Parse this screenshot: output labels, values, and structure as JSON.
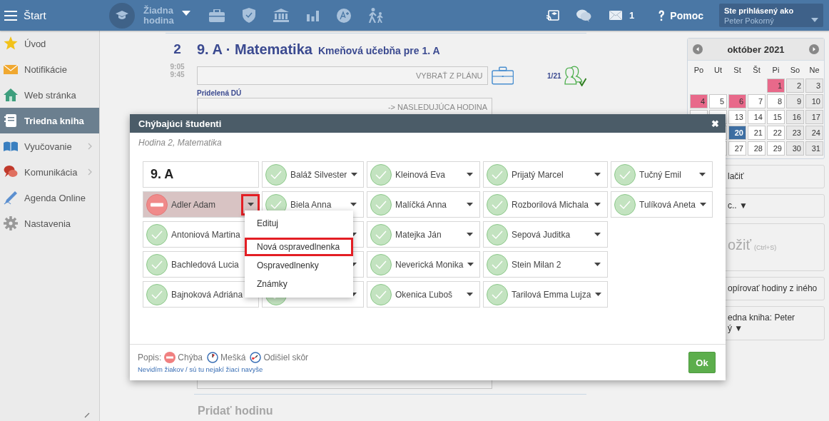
{
  "topbar": {
    "brand": "Štart",
    "lesson_selector": "Žiadna hodina",
    "mail_count": "1",
    "help": "Pomoc",
    "user_caption": "Ste prihlásený ako",
    "user_name": "Peter Pokorný"
  },
  "sidebar": {
    "items": [
      {
        "label": "Úvod",
        "selected": false,
        "has_submenu": false
      },
      {
        "label": "Notifikácie",
        "selected": false,
        "has_submenu": false
      },
      {
        "label": "Web stránka",
        "selected": false,
        "has_submenu": false
      },
      {
        "label": "Triedna kniha",
        "selected": true,
        "has_submenu": false
      },
      {
        "label": "Vyučovanie",
        "selected": false,
        "has_submenu": true
      },
      {
        "label": "Komunikácia",
        "selected": false,
        "has_submenu": true
      },
      {
        "label": "Agenda Online",
        "selected": false,
        "has_submenu": false
      },
      {
        "label": "Nastavenia",
        "selected": false,
        "has_submenu": false
      }
    ]
  },
  "lesson": {
    "number": "2",
    "start": "9:05",
    "end": "9:45",
    "title": "9. A · Matematika",
    "room": "Kmeňová učebňa pre 1. A",
    "plan_button": "VYBRAŤ Z PLÁNU",
    "attendance": "1/21",
    "homework_label": "Pridelená DÚ",
    "homework_button": "-> NASLEDUJÚCA HODINA",
    "add_lesson": "Pridať hodinu"
  },
  "calendar": {
    "title": "október 2021",
    "weekdays": [
      "Po",
      "Ut",
      "St",
      "Št",
      "Pi",
      "So",
      "Ne"
    ],
    "weeks": [
      [
        {
          "kind": "empty"
        },
        {
          "kind": "empty"
        },
        {
          "kind": "empty"
        },
        {
          "kind": "empty"
        },
        {
          "kind": "day",
          "day": "1",
          "weekend": false,
          "marked": true,
          "selected": false
        },
        {
          "kind": "day",
          "day": "2",
          "weekend": true,
          "marked": false,
          "selected": false
        },
        {
          "kind": "day",
          "day": "3",
          "weekend": true,
          "marked": false,
          "selected": false
        }
      ],
      [
        {
          "kind": "day",
          "day": "4",
          "weekend": false,
          "marked": true,
          "selected": false
        },
        {
          "kind": "day",
          "day": "5",
          "weekend": false,
          "marked": false,
          "selected": false
        },
        {
          "kind": "day",
          "day": "6",
          "weekend": false,
          "marked": true,
          "selected": false
        },
        {
          "kind": "day",
          "day": "7",
          "weekend": false,
          "marked": false,
          "selected": false
        },
        {
          "kind": "day",
          "day": "8",
          "weekend": false,
          "marked": false,
          "selected": false
        },
        {
          "kind": "day",
          "day": "9",
          "weekend": true,
          "marked": false,
          "selected": false
        },
        {
          "kind": "day",
          "day": "10",
          "weekend": true,
          "marked": false,
          "selected": false
        }
      ],
      [
        {
          "kind": "covered"
        },
        {
          "kind": "covered"
        },
        {
          "kind": "day",
          "day": "13",
          "weekend": false,
          "marked": false,
          "selected": false
        },
        {
          "kind": "day",
          "day": "14",
          "weekend": false,
          "marked": false,
          "selected": false
        },
        {
          "kind": "day",
          "day": "15",
          "weekend": false,
          "marked": false,
          "selected": false
        },
        {
          "kind": "day",
          "day": "16",
          "weekend": true,
          "marked": false,
          "selected": false
        },
        {
          "kind": "day",
          "day": "17",
          "weekend": true,
          "marked": false,
          "selected": false
        }
      ],
      [
        {
          "kind": "empty"
        },
        {
          "kind": "covered"
        },
        {
          "kind": "day",
          "day": "20",
          "weekend": false,
          "marked": false,
          "selected": true
        },
        {
          "kind": "day",
          "day": "21",
          "weekend": false,
          "marked": false,
          "selected": false
        },
        {
          "kind": "day",
          "day": "22",
          "weekend": false,
          "marked": false,
          "selected": false
        },
        {
          "kind": "day",
          "day": "23",
          "weekend": true,
          "marked": false,
          "selected": false
        },
        {
          "kind": "day",
          "day": "24",
          "weekend": true,
          "marked": false,
          "selected": false
        }
      ],
      [
        {
          "kind": "empty"
        },
        {
          "kind": "covered"
        },
        {
          "kind": "day",
          "day": "27",
          "weekend": false,
          "marked": false,
          "selected": false
        },
        {
          "kind": "day",
          "day": "28",
          "weekend": false,
          "marked": false,
          "selected": false
        },
        {
          "kind": "day",
          "day": "29",
          "weekend": false,
          "marked": false,
          "selected": false
        },
        {
          "kind": "day",
          "day": "30",
          "weekend": true,
          "marked": false,
          "selected": false
        },
        {
          "kind": "day",
          "day": "31",
          "weekend": true,
          "marked": false,
          "selected": false
        }
      ]
    ]
  },
  "side_actions": [
    {
      "kind": "plain",
      "text": "lačiť"
    },
    {
      "kind": "plain",
      "text": "c.. ▼"
    },
    {
      "kind": "save",
      "text": "ožiť",
      "hint": "(Ctrl+S)"
    },
    {
      "kind": "plain",
      "text": "opírovať hodiny z iného"
    },
    {
      "kind": "plain",
      "text": "edna kniha: Peter",
      "text_2": "ý ▼"
    }
  ],
  "modal": {
    "title": "Chýbajúci študenti",
    "close": "✖",
    "subtitle": "Hodina 2, Matematika",
    "columns": [
      [
        {
          "kind": "class",
          "label": "9. A"
        },
        {
          "kind": "student",
          "name": "Adler Adam",
          "absent": true,
          "caret_highlighted": true
        },
        {
          "kind": "student",
          "name": "Antoniová Martina",
          "absent": false,
          "caret_highlighted": false
        },
        {
          "kind": "student",
          "name": "Bachledová Lucia",
          "absent": false,
          "caret_highlighted": false
        },
        {
          "kind": "student",
          "name": "Bajnoková Adriána",
          "absent": false,
          "caret_highlighted": false
        }
      ],
      [
        {
          "kind": "student",
          "name": "Baláž Silvester",
          "absent": false,
          "caret_highlighted": false
        },
        {
          "kind": "student",
          "name": "Biela Anna",
          "absent": false,
          "caret_highlighted": false
        },
        {
          "kind": "student",
          "caret_highlighted": false
        },
        {
          "kind": "student",
          "caret_highlighted": false
        },
        {
          "kind": "student",
          "absent": false,
          "caret_highlighted": false
        }
      ],
      [
        {
          "kind": "student",
          "name": "Kleinová Eva",
          "absent": false,
          "caret_highlighted": false
        },
        {
          "kind": "student",
          "name": "Malíčká Anna",
          "absent": false,
          "caret_highlighted": false
        },
        {
          "kind": "student",
          "name": "Matejka Ján",
          "absent": false,
          "caret_highlighted": false
        },
        {
          "kind": "student",
          "name": "Neverická Monika",
          "absent": false,
          "caret_highlighted": false
        },
        {
          "kind": "student",
          "name": "Okenica Ľuboš",
          "absent": false,
          "caret_highlighted": false
        }
      ],
      [
        {
          "kind": "student",
          "name": "Prijatý Marcel",
          "absent": false,
          "caret_highlighted": false
        },
        {
          "kind": "student",
          "name": "Rozborilová Michala",
          "absent": false,
          "caret_highlighted": false
        },
        {
          "kind": "student",
          "name": "Sepová Juditka",
          "absent": false,
          "caret_highlighted": false
        },
        {
          "kind": "student",
          "name": "Stein Milan 2",
          "absent": false,
          "caret_highlighted": false
        },
        {
          "kind": "student",
          "name": "Tarilová Emma Lujza",
          "absent": false,
          "caret_highlighted": false
        }
      ],
      [
        {
          "kind": "student",
          "name": "Tučný Emil",
          "absent": false,
          "caret_highlighted": false
        },
        {
          "kind": "student",
          "name": "Tulíková Aneta",
          "absent": false,
          "caret_highlighted": false
        }
      ]
    ],
    "menu": [
      {
        "label": "Edituj",
        "highlighted": false
      },
      {
        "label": "Nová ospravedlnenka",
        "highlighted": true
      },
      {
        "label": "Ospravedlnenky",
        "highlighted": false
      },
      {
        "label": "Známky",
        "highlighted": false
      }
    ],
    "legend_label": "Popis:",
    "legend": [
      {
        "kind": "absent",
        "label": "Chýba"
      },
      {
        "kind": "late",
        "label": "Mešká"
      },
      {
        "kind": "left_early",
        "label": "Odišiel skôr"
      }
    ],
    "link": "Nevidím žiakov / sú tu nejakí žiaci navyše",
    "ok": "Ok"
  }
}
